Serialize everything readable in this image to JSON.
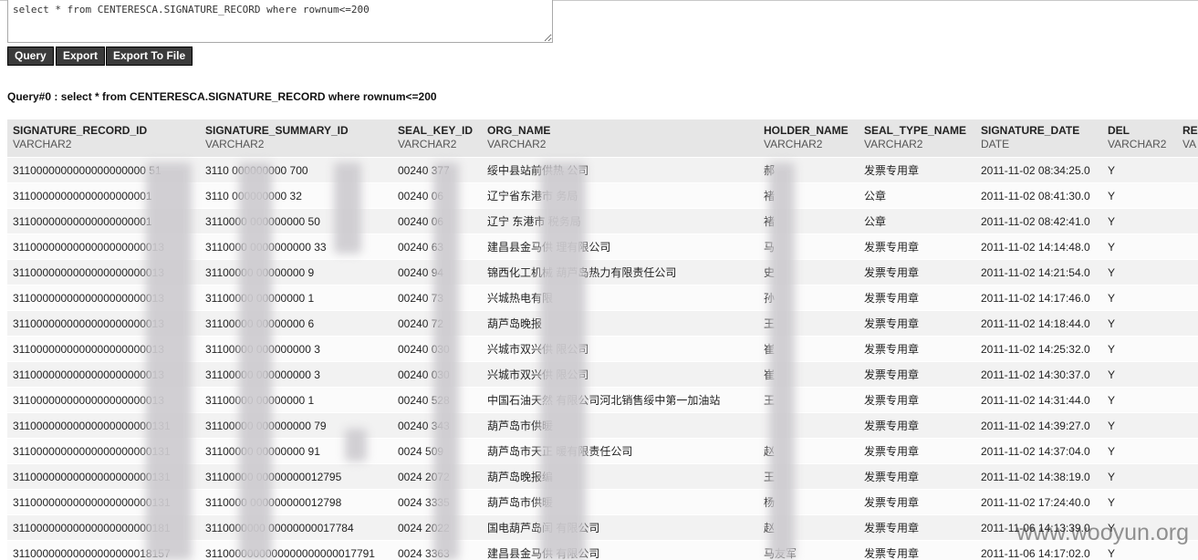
{
  "query_box": {
    "value": "select * from CENTERESCA.SIGNATURE_RECORD where rownum<=200"
  },
  "toolbar": {
    "query_label": "Query",
    "export_label": "Export",
    "export_file_label": "Export To File"
  },
  "result": {
    "title": "Query#0 : select * from CENTERESCA.SIGNATURE_RECORD where rownum<=200",
    "columns": [
      {
        "name": "SIGNATURE_RECORD_ID",
        "type": "VARCHAR2"
      },
      {
        "name": "SIGNATURE_SUMMARY_ID",
        "type": "VARCHAR2"
      },
      {
        "name": "SEAL_KEY_ID",
        "type": "VARCHAR2"
      },
      {
        "name": "ORG_NAME",
        "type": "VARCHAR2"
      },
      {
        "name": "HOLDER_NAME",
        "type": "VARCHAR2"
      },
      {
        "name": "SEAL_TYPE_NAME",
        "type": "VARCHAR2"
      },
      {
        "name": "SIGNATURE_DATE",
        "type": "DATE"
      },
      {
        "name": "DEL",
        "type": "VARCHAR2"
      },
      {
        "name": "RE",
        "type": "VA"
      }
    ],
    "rows": [
      [
        "3110000000000000000000     51",
        "3110         000000000     700",
        "00240    377",
        "绥中县站前供热        公司",
        "郝",
        "发票专用章",
        "2011-11-02 08:34:25.0",
        "Y",
        ""
      ],
      [
        "31100000000000000000001",
        "3110          000000000     32",
        "00240    06",
        "辽宁省东港市        务局",
        "褚",
        "公章",
        "2011-11-02 08:41:30.0",
        "Y",
        ""
      ],
      [
        "31100000000000000000001",
        "3110000       000000000    50",
        "00240    06",
        "辽宁    东港市      税务局",
        "褚",
        "公章",
        "2011-11-02 08:42:41.0",
        "Y",
        ""
      ],
      [
        "3110000000000000000000013",
        "3110000       0000000000    33",
        "00240    63",
        "建昌县金马供      理有限公司",
        "马",
        "发票专用章",
        "2011-11-02 14:14:48.0",
        "Y",
        ""
      ],
      [
        "3110000000000000000000013",
        "31100000         00000000    9",
        "00240    94",
        "锦西化工机械      葫芦岛热力有限责任公司",
        "史",
        "发票专用章",
        "2011-11-02 14:21:54.0",
        "Y",
        ""
      ],
      [
        "3110000000000000000000013",
        "31100000         00000000    1",
        "00240    73",
        "兴城热电有限",
        "孙",
        "发票专用章",
        "2011-11-02 14:17:46.0",
        "Y",
        ""
      ],
      [
        "3110000000000000000000013",
        "31100000         00000000    6",
        "00240    72",
        "葫芦岛晚报",
        "王",
        "发票专用章",
        "2011-11-02 14:18:44.0",
        "Y",
        ""
      ],
      [
        "3110000000000000000000013",
        "31100000         000000000    3",
        "00240    030",
        "兴城市双兴供      限公司",
        "崔",
        "发票专用章",
        "2011-11-02 14:25:32.0",
        "Y",
        ""
      ],
      [
        "3110000000000000000000013",
        "31100000         000000000    3",
        "00240    030",
        "兴城市双兴供      限公司",
        "崔",
        "发票专用章",
        "2011-11-02 14:30:37.0",
        "Y",
        ""
      ],
      [
        "3110000000000000000000013",
        "31100000         00000000    1",
        "00240    528",
        "中国石油天然      有限公司河北销售绥中第一加油站",
        "王",
        "发票专用章",
        "2011-11-02 14:31:44.0",
        "Y",
        ""
      ],
      [
        "31100000000000000000000131",
        "31100000         000000000    79",
        "00240    343",
        "葫芦岛市供暖",
        "",
        "发票专用章",
        "2011-11-02 14:39:27.0",
        "Y",
        ""
      ],
      [
        "31100000000000000000000131",
        "31100000         00000000    91",
        "0024    509",
        "葫芦岛市天正      暖有限责任公司",
        "赵",
        "发票专用章",
        "2011-11-02 14:37:04.0",
        "Y",
        ""
      ],
      [
        "31100000000000000000000131",
        "31100000         00000000012795",
        "0024    2072",
        "葫芦岛晚报编",
        "王",
        "发票专用章",
        "2011-11-02 14:38:19.0",
        "Y",
        ""
      ],
      [
        "31100000000000000000000131",
        "3110000        000000000012798",
        "0024    3335",
        "葫芦岛市供暖",
        "杨",
        "发票专用章",
        "2011-11-02 17:24:40.0",
        "Y",
        ""
      ],
      [
        "31100000000000000000000181",
        "3110000000        00000000017784",
        "0024    2022",
        "国电葫芦岛闰      有限公司",
        "赵",
        "发票专用章",
        "2011-11-06 14:13:39.0",
        "Y",
        ""
      ],
      [
        "31100000000000000000018157",
        "3110000000000000000000017791",
        "0024    3363",
        "建昌县金马供      有限公司",
        "马友军",
        "发票专用章",
        "2011-11-06 14:17:02.0",
        "Y",
        ""
      ]
    ]
  },
  "watermark": "www.wooyun.org"
}
